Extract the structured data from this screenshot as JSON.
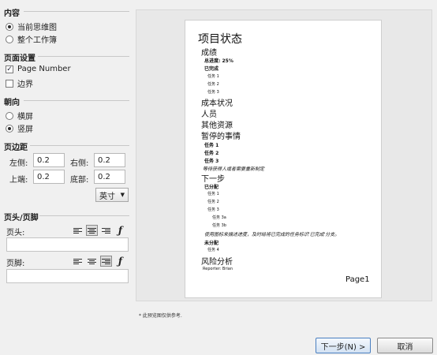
{
  "left": {
    "content": {
      "title": "内容",
      "options": [
        "当前思维图",
        "整个工作簿"
      ],
      "selected": 0
    },
    "page_setup": {
      "title": "页面设置",
      "page_number_label": "Page Number",
      "page_number_checked": true,
      "border_label": "边界",
      "border_checked": false
    },
    "orientation": {
      "title": "朝向",
      "options": [
        "横屏",
        "竖屏"
      ],
      "selected": 1
    },
    "margins": {
      "title": "页边距",
      "left_label": "左侧:",
      "left_value": "0.2",
      "right_label": "右侧:",
      "right_value": "0.2",
      "top_label": "上端:",
      "top_value": "0.2",
      "bottom_label": "底部:",
      "bottom_value": "0.2",
      "unit": "英寸"
    },
    "header_footer": {
      "title": "页头/页脚",
      "header_label": "页头:",
      "footer_label": "页脚:",
      "header_align": "center",
      "footer_align": "right"
    }
  },
  "preview": {
    "title": "项目状态",
    "l1": "成绩",
    "l2": "总进度: 25%",
    "l3": "已完成",
    "l4": "任务 1",
    "l5": "任务 2",
    "l6": "任务 3",
    "l7": "成本状况",
    "l8": "人员",
    "l9": "其他资源",
    "l10": "暂停的事情",
    "l11": "任务 1",
    "l12": "任务 2",
    "l13": "任务 3",
    "l14": "等待获得人或者需要重新制定",
    "l15": "下一步",
    "l16": "已分配",
    "l17": "任务 1",
    "l18": "任务 2",
    "l19": "任务 3",
    "l20": "任务 3a",
    "l21": "任务 3b",
    "l22": "使用图标来描述进度，及时给将已完成的任务标识'已完成'分支。",
    "l23": "未分配",
    "l24": "任务 4",
    "l25": "风险分析",
    "l26": "Reporter: Brian",
    "page_label": "Page1"
  },
  "note": "* 此预览图仅供参考.",
  "buttons": {
    "next": "下一步(N) >",
    "cancel": "取消"
  }
}
